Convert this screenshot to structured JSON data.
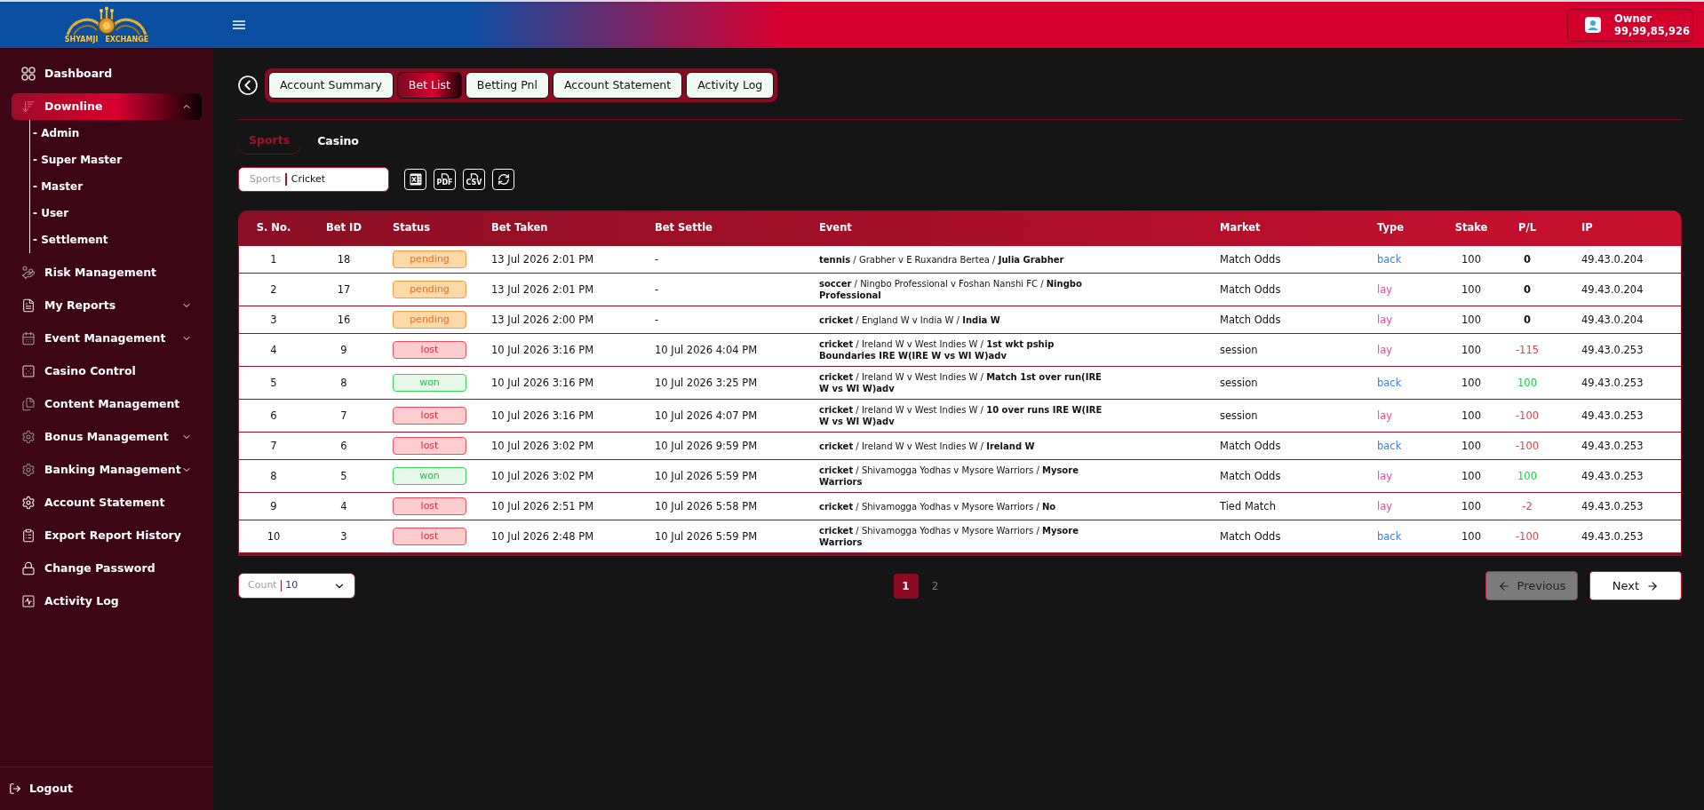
{
  "sidebar": {
    "logo": {
      "line_1": "SHYAMJI",
      "line_2": "EXCHANGE"
    },
    "items": [
      {
        "label": "Dashboard",
        "selected": false
      },
      {
        "label": "Downline",
        "selected": true,
        "expanded": true,
        "children": [
          {
            "label": "- Admin",
            "selected": false
          },
          {
            "label": "- Super Master",
            "selected": false
          },
          {
            "label": "- Master",
            "selected": false
          },
          {
            "label": "- User",
            "selected": false
          },
          {
            "label": "- Settlement",
            "selected": false
          }
        ]
      },
      {
        "label": "Risk Management",
        "selected": false
      },
      {
        "label": "My Reports",
        "selected": false,
        "expanded": false
      },
      {
        "label": "Event Management",
        "selected": false,
        "expanded": false
      },
      {
        "label": "Casino Control",
        "selected": false
      },
      {
        "label": "Content Management",
        "selected": false
      },
      {
        "label": "Bonus Management",
        "selected": false,
        "expanded": false
      },
      {
        "label": "Banking Management",
        "selected": false,
        "expanded": false
      },
      {
        "label": "Account Statement",
        "selected": false
      },
      {
        "label": "Export Report History",
        "selected": false
      },
      {
        "label": "Change Password",
        "selected": false
      },
      {
        "label": "Activity Log",
        "selected": false
      }
    ],
    "logout": {
      "label": "Logout"
    }
  },
  "header": {
    "user": {
      "role": "Owner",
      "balance": "99,99,85,926"
    }
  },
  "page_tabs": [
    {
      "label": "Account Summary",
      "selected": false
    },
    {
      "label": "Bet List",
      "selected": true
    },
    {
      "label": "Betting Pnl",
      "selected": false
    },
    {
      "label": "Account Statement",
      "selected": false
    },
    {
      "label": "Activity Log",
      "selected": false
    }
  ],
  "sub_tabs": [
    {
      "label": "Sports",
      "selected": true
    },
    {
      "label": "Casino",
      "selected": false
    }
  ],
  "filter": {
    "label": "Sports",
    "value": "Cricket"
  },
  "export_buttons": [
    {
      "kind": "excel"
    },
    {
      "kind": "pdf",
      "label": "PDF"
    },
    {
      "kind": "csv",
      "label": "CSV"
    },
    {
      "kind": "refresh"
    }
  ],
  "table": {
    "columns": [
      "S. No.",
      "Bet ID",
      "Status",
      "Bet Taken",
      "Bet Settle",
      "Event",
      "Market",
      "Type",
      "Stake",
      "P/L",
      "IP"
    ],
    "rows": [
      {
        "sno": "1",
        "bet_id": "18",
        "status": {
          "label": "pending",
          "kind": "pending"
        },
        "bet_taken": "13 Jul 2026 2:01 PM",
        "bet_settle": "-",
        "event": "**tennis** / Grabher v E Ruxandra Bertea / **Julia Grabher**",
        "market": "Match Odds",
        "type": {
          "label": "back",
          "kind": "back"
        },
        "stake": "100",
        "pl": {
          "label": "0",
          "kind": "even"
        },
        "ip": "49.43.0.204"
      },
      {
        "sno": "2",
        "bet_id": "17",
        "status": {
          "label": "pending",
          "kind": "pending"
        },
        "bet_taken": "13 Jul 2026 2:01 PM",
        "bet_settle": "-",
        "event": "**soccer** / Ningbo Professional v Foshan Nanshi FC / **Ningbo Professional**",
        "market": "Match Odds",
        "type": {
          "label": "lay",
          "kind": "lay"
        },
        "stake": "100",
        "pl": {
          "label": "0",
          "kind": "even"
        },
        "ip": "49.43.0.204"
      },
      {
        "sno": "3",
        "bet_id": "16",
        "status": {
          "label": "pending",
          "kind": "pending"
        },
        "bet_taken": "13 Jul 2026 2:00 PM",
        "bet_settle": "-",
        "event": "**cricket** / England W v India W / **India W**",
        "market": "Match Odds",
        "type": {
          "label": "lay",
          "kind": "lay"
        },
        "stake": "100",
        "pl": {
          "label": "0",
          "kind": "even"
        },
        "ip": "49.43.0.204"
      },
      {
        "sno": "4",
        "bet_id": "9",
        "status": {
          "label": "lost",
          "kind": "lost"
        },
        "bet_taken": "10 Jul 2026 3:16 PM",
        "bet_settle": "10 Jul 2026 4:04 PM",
        "event": "**cricket** / Ireland W v West Indies W / **1st wkt pship Boundaries IRE W(IRE W vs WI W)adv**",
        "market": "session",
        "type": {
          "label": "lay",
          "kind": "lay"
        },
        "stake": "100",
        "pl": {
          "label": "-115",
          "kind": "loss"
        },
        "ip": "49.43.0.253"
      },
      {
        "sno": "5",
        "bet_id": "8",
        "status": {
          "label": "won",
          "kind": "won"
        },
        "bet_taken": "10 Jul 2026 3:16 PM",
        "bet_settle": "10 Jul 2026 3:25 PM",
        "event": "**cricket** / Ireland W v West Indies W / **Match 1st over run(IRE W vs WI W)adv**",
        "market": "session",
        "type": {
          "label": "back",
          "kind": "back"
        },
        "stake": "100",
        "pl": {
          "label": "100",
          "kind": "profit"
        },
        "ip": "49.43.0.253"
      },
      {
        "sno": "6",
        "bet_id": "7",
        "status": {
          "label": "lost",
          "kind": "lost"
        },
        "bet_taken": "10 Jul 2026 3:16 PM",
        "bet_settle": "10 Jul 2026 4:07 PM",
        "event": "**cricket** / Ireland W v West Indies W / **10 over runs IRE W(IRE W vs WI W)adv**",
        "market": "session",
        "type": {
          "label": "lay",
          "kind": "lay"
        },
        "stake": "100",
        "pl": {
          "label": "-100",
          "kind": "loss"
        },
        "ip": "49.43.0.253"
      },
      {
        "sno": "7",
        "bet_id": "6",
        "status": {
          "label": "lost",
          "kind": "lost"
        },
        "bet_taken": "10 Jul 2026 3:02 PM",
        "bet_settle": "10 Jul 2026 9:59 PM",
        "event": "**cricket** / Ireland W v West Indies W / **Ireland W**",
        "market": "Match Odds",
        "type": {
          "label": "back",
          "kind": "back"
        },
        "stake": "100",
        "pl": {
          "label": "-100",
          "kind": "loss"
        },
        "ip": "49.43.0.253"
      },
      {
        "sno": "8",
        "bet_id": "5",
        "status": {
          "label": "won",
          "kind": "won"
        },
        "bet_taken": "10 Jul 2026 3:02 PM",
        "bet_settle": "10 Jul 2026 5:59 PM",
        "event": "**cricket** / Shivamogga Yodhas v Mysore Warriors / **Mysore Warriors**",
        "market": "Match Odds",
        "type": {
          "label": "lay",
          "kind": "lay"
        },
        "stake": "100",
        "pl": {
          "label": "100",
          "kind": "profit"
        },
        "ip": "49.43.0.253"
      },
      {
        "sno": "9",
        "bet_id": "4",
        "status": {
          "label": "lost",
          "kind": "lost"
        },
        "bet_taken": "10 Jul 2026 2:51 PM",
        "bet_settle": "10 Jul 2026 5:58 PM",
        "event": "**cricket** / Shivamogga Yodhas v Mysore Warriors / **No**",
        "market": "Tied Match",
        "type": {
          "label": "lay",
          "kind": "lay"
        },
        "stake": "100",
        "pl": {
          "label": "-2",
          "kind": "loss"
        },
        "ip": "49.43.0.253"
      },
      {
        "sno": "10",
        "bet_id": "3",
        "status": {
          "label": "lost",
          "kind": "lost"
        },
        "bet_taken": "10 Jul 2026 2:48 PM",
        "bet_settle": "10 Jul 2026 5:59 PM",
        "event": "**cricket** / Shivamogga Yodhas v Mysore Warriors / **Mysore Warriors**",
        "market": "Match Odds",
        "type": {
          "label": "back",
          "kind": "back"
        },
        "stake": "100",
        "pl": {
          "label": "-100",
          "kind": "loss"
        },
        "ip": "49.43.0.253"
      }
    ]
  },
  "pagination": {
    "count": {
      "label": "Count",
      "value": "10"
    },
    "pages": [
      {
        "label": "1",
        "selected": true
      },
      {
        "label": "2",
        "selected": false
      }
    ],
    "previous": {
      "label": "Previous",
      "disabled": true
    },
    "next": {
      "label": "Next",
      "disabled": false
    }
  }
}
